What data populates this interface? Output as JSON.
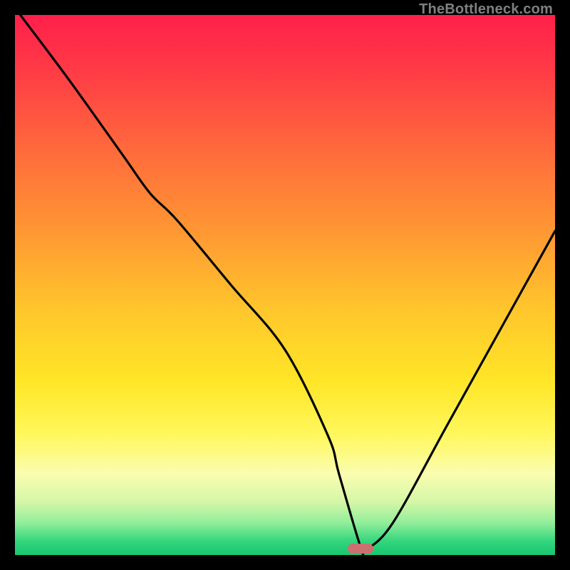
{
  "watermark": "TheBottleneck.com",
  "chart_data": {
    "type": "line",
    "title": "",
    "xlabel": "",
    "ylabel": "",
    "xlim": [
      0,
      100
    ],
    "ylim": [
      0,
      100
    ],
    "series": [
      {
        "name": "bottleneck-curve",
        "x": [
          1,
          10,
          20,
          25,
          30,
          40,
          50,
          58,
          60,
          64,
          65,
          70,
          80,
          90,
          100
        ],
        "values": [
          100,
          88,
          74,
          67,
          62,
          50,
          38,
          22,
          15,
          1.5,
          1,
          6,
          24,
          42,
          60
        ]
      }
    ],
    "gradient_stops": [
      {
        "pos": 0.0,
        "color": "#FF1F4B"
      },
      {
        "pos": 0.1,
        "color": "#FF3A46"
      },
      {
        "pos": 0.25,
        "color": "#FF6A3C"
      },
      {
        "pos": 0.4,
        "color": "#FF9733"
      },
      {
        "pos": 0.55,
        "color": "#FFC72C"
      },
      {
        "pos": 0.68,
        "color": "#FFE627"
      },
      {
        "pos": 0.78,
        "color": "#FFF85F"
      },
      {
        "pos": 0.85,
        "color": "#FAFDB0"
      },
      {
        "pos": 0.9,
        "color": "#D6F7A7"
      },
      {
        "pos": 0.94,
        "color": "#93EE9B"
      },
      {
        "pos": 0.975,
        "color": "#32D57C"
      },
      {
        "pos": 1.0,
        "color": "#18C76F"
      }
    ],
    "marker": {
      "x": 64,
      "y": 1.2,
      "color": "#CC6F71"
    },
    "curve_color": "#000000"
  }
}
